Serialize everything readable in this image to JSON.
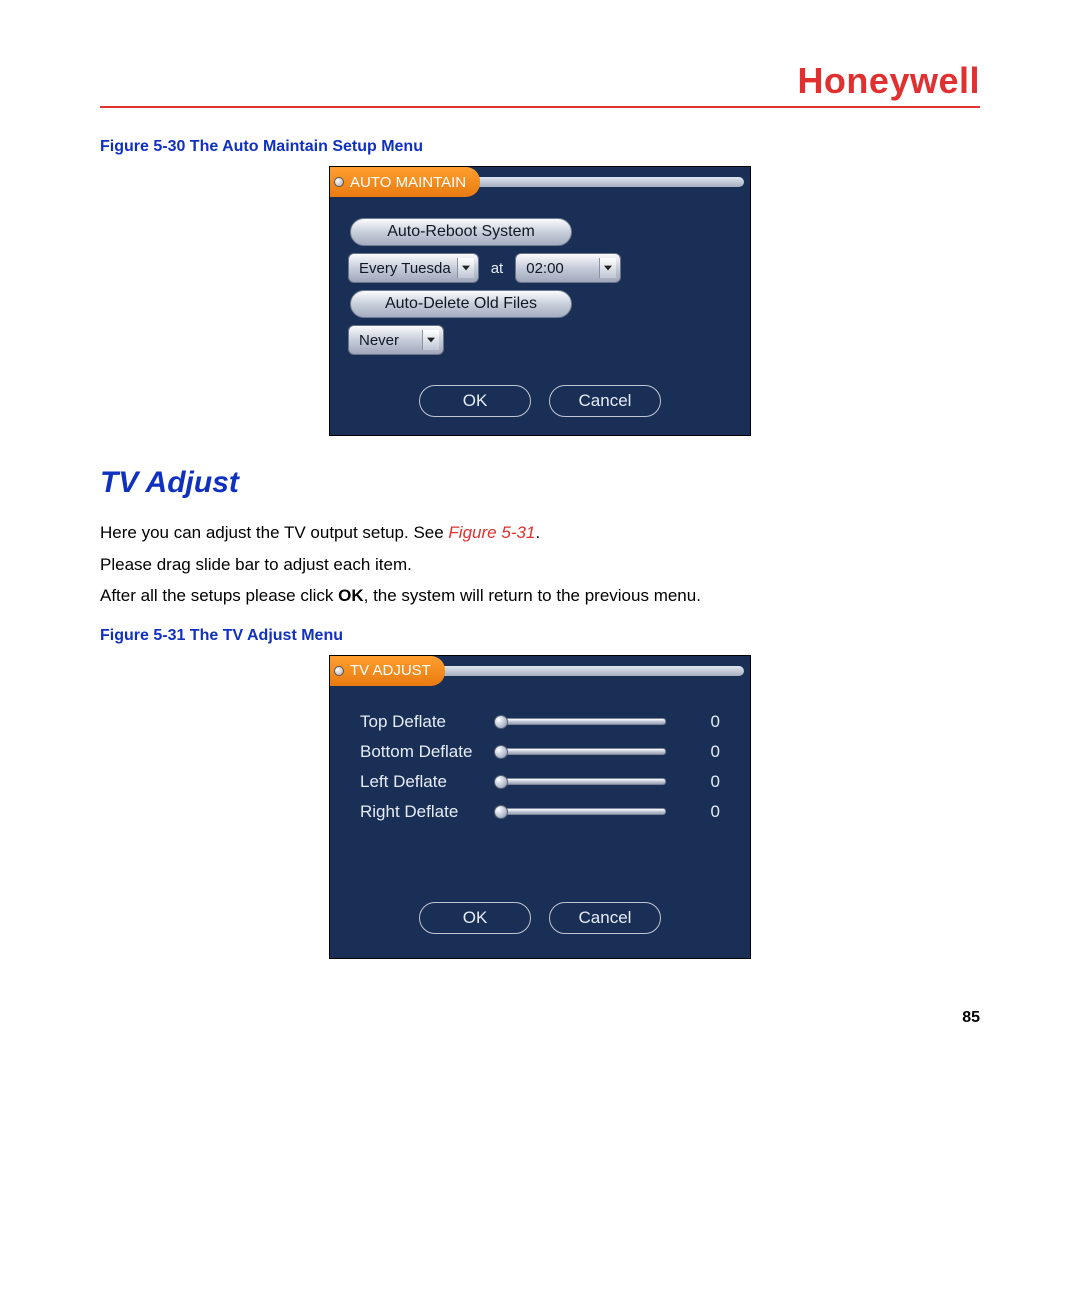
{
  "brand": "Honeywell",
  "figure1_caption": "Figure 5-30 The Auto Maintain Setup Menu",
  "section_heading": "TV Adjust",
  "body": {
    "line1_pre": "Here you can adjust the TV output setup. See ",
    "line1_ref": "Figure 5-31",
    "line1_post": ".",
    "line2": "Please drag slide bar to adjust each item.",
    "line3_pre": "After all the setups please click ",
    "line3_bold": "OK",
    "line3_post": ", the system will return to the previous menu."
  },
  "figure2_caption": "Figure 5-31 The TV Adjust Menu",
  "auto_maintain": {
    "title": "AUTO MAINTAIN",
    "reboot_label": "Auto-Reboot System",
    "day_value": "Every Tuesda",
    "at_label": "at",
    "time_value": "02:00",
    "delete_label": "Auto-Delete Old Files",
    "delete_value": "Never",
    "ok": "OK",
    "cancel": "Cancel"
  },
  "tv_adjust": {
    "title": "TV ADJUST",
    "rows": [
      {
        "label": "Top Deflate",
        "value": "0"
      },
      {
        "label": "Bottom Deflate",
        "value": "0"
      },
      {
        "label": "Left Deflate",
        "value": "0"
      },
      {
        "label": "Right Deflate",
        "value": "0"
      }
    ],
    "ok": "OK",
    "cancel": "Cancel"
  },
  "page_number": "85"
}
